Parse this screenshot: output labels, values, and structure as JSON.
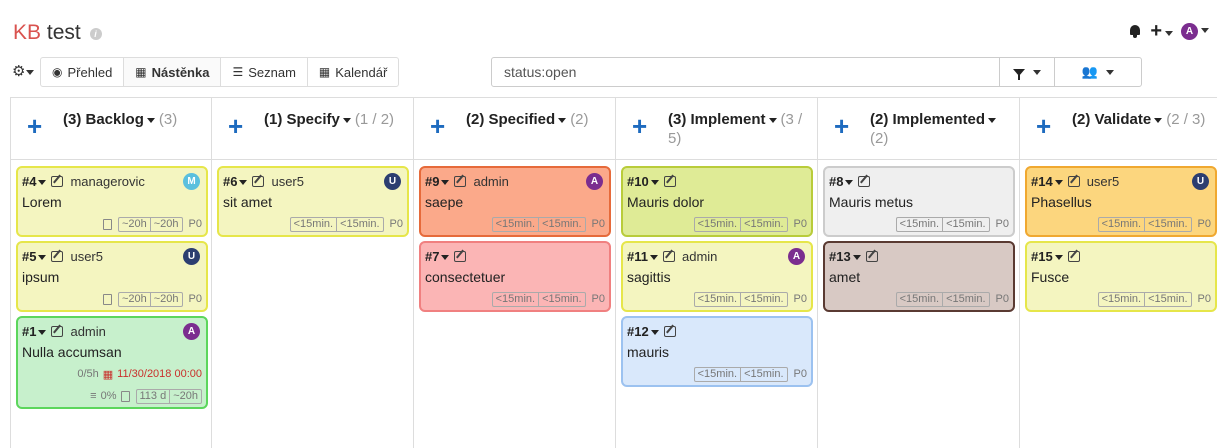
{
  "header": {
    "kb": "KB",
    "project": "test",
    "info_icon": "info-icon",
    "user_avatar": {
      "initial": "A",
      "color": "#7b2d8f"
    }
  },
  "toolbar": {
    "views": [
      {
        "icon": "eye-icon",
        "glyph": "◉",
        "label": "Přehled",
        "active": false
      },
      {
        "icon": "grid-icon",
        "glyph": "▦",
        "label": "Nástěnka",
        "active": true
      },
      {
        "icon": "list-icon",
        "glyph": "☰",
        "label": "Seznam",
        "active": false
      },
      {
        "icon": "calendar-icon",
        "glyph": "▦",
        "label": "Kalendář",
        "active": false
      }
    ],
    "filter_value": "status:open"
  },
  "columns": [
    {
      "title": "(3) Backlog",
      "count": "(3)",
      "cards": [
        {
          "id": "#4",
          "assignee": "managerovic",
          "title": "Lorem",
          "avatar": "M",
          "avatar_color": "#5bc0de",
          "bg": "#f4f5c0",
          "border": "#e6e64a",
          "doc": true,
          "t1": "~20h",
          "t2": "~20h",
          "prio": "P0"
        },
        {
          "id": "#5",
          "assignee": "user5",
          "title": "ipsum",
          "avatar": "U",
          "avatar_color": "#2c3e70",
          "bg": "#f4f5c0",
          "border": "#e6e64a",
          "doc": true,
          "t1": "~20h",
          "t2": "~20h",
          "prio": "P0"
        },
        {
          "id": "#1",
          "assignee": "admin",
          "title": "Nulla accumsan",
          "avatar": "A",
          "avatar_color": "#7b2d8f",
          "bg": "#c7f0cc",
          "border": "#5cd65c",
          "doc": true,
          "t1": "113 d",
          "t2": "~20h",
          "prio": "",
          "extra_hours": "0/5h",
          "due": "11/30/2018 00:00",
          "progress": "0%"
        }
      ]
    },
    {
      "title": "(1) Specify",
      "count": "(1 / 2)",
      "cards": [
        {
          "id": "#6",
          "assignee": "user5",
          "title": "sit amet",
          "avatar": "U",
          "avatar_color": "#2c3e70",
          "bg": "#f4f5c0",
          "border": "#e6e64a",
          "doc": false,
          "t1": "<15min.",
          "t2": "<15min.",
          "prio": "P0"
        }
      ]
    },
    {
      "title": "(2) Specified",
      "count": "(2)",
      "cards": [
        {
          "id": "#9",
          "assignee": "admin",
          "title": "saepe",
          "avatar": "A",
          "avatar_color": "#7b2d8f",
          "bg": "#fba98a",
          "border": "#e66a3a",
          "doc": false,
          "t1": "<15min.",
          "t2": "<15min.",
          "prio": "P0"
        },
        {
          "id": "#7",
          "assignee": "",
          "title": "consectetuer",
          "avatar": "",
          "avatar_color": "",
          "bg": "#fbb5b5",
          "border": "#f08080",
          "doc": false,
          "t1": "<15min.",
          "t2": "<15min.",
          "prio": "P0"
        }
      ]
    },
    {
      "title": "(3) Implement",
      "count": "(3 / 5)",
      "cards": [
        {
          "id": "#10",
          "assignee": "",
          "title": "Mauris dolor",
          "avatar": "",
          "avatar_color": "",
          "bg": "#dfeb96",
          "border": "#b9cc3a",
          "doc": false,
          "t1": "<15min.",
          "t2": "<15min.",
          "prio": "P0"
        },
        {
          "id": "#11",
          "assignee": "admin",
          "title": "sagittis",
          "avatar": "A",
          "avatar_color": "#7b2d8f",
          "bg": "#f4f5c0",
          "border": "#e6e64a",
          "doc": false,
          "t1": "<15min.",
          "t2": "<15min.",
          "prio": "P0"
        },
        {
          "id": "#12",
          "assignee": "",
          "title": "mauris",
          "avatar": "",
          "avatar_color": "",
          "bg": "#d9e8fb",
          "border": "#9cc2f0",
          "doc": false,
          "t1": "<15min.",
          "t2": "<15min.",
          "prio": "P0"
        }
      ]
    },
    {
      "title": "(2) Implemented",
      "count": "(2)",
      "cards": [
        {
          "id": "#8",
          "assignee": "",
          "title": "Mauris metus",
          "avatar": "",
          "avatar_color": "",
          "bg": "#efefef",
          "border": "#cccccc",
          "doc": false,
          "t1": "<15min.",
          "t2": "<15min.",
          "prio": "P0"
        },
        {
          "id": "#13",
          "assignee": "",
          "title": "amet",
          "avatar": "",
          "avatar_color": "",
          "bg": "#d8c9c4",
          "border": "#5a3a32",
          "doc": false,
          "t1": "<15min.",
          "t2": "<15min.",
          "prio": "P0"
        }
      ]
    },
    {
      "title": "(2) Validate",
      "count": "(2 / 3)",
      "cards": [
        {
          "id": "#14",
          "assignee": "user5",
          "title": "Phasellus",
          "avatar": "U",
          "avatar_color": "#2c3e70",
          "bg": "#fcd67e",
          "border": "#f0a830",
          "doc": false,
          "t1": "<15min.",
          "t2": "<15min.",
          "prio": "P0"
        },
        {
          "id": "#15",
          "assignee": "",
          "title": "Fusce",
          "avatar": "",
          "avatar_color": "",
          "bg": "#f4f5c0",
          "border": "#e6e64a",
          "doc": false,
          "t1": "<15min.",
          "t2": "<15min.",
          "prio": "P0"
        }
      ]
    }
  ]
}
